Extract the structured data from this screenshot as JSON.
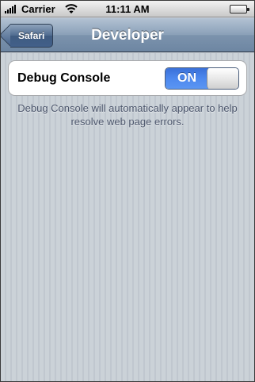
{
  "status_bar": {
    "carrier": "Carrier",
    "time": "11:11 AM",
    "icons": [
      "signal-bars-icon",
      "wifi-icon",
      "battery-icon"
    ]
  },
  "nav_bar": {
    "back_label": "Safari",
    "title": "Developer"
  },
  "settings": {
    "debug_console": {
      "label": "Debug Console",
      "toggle_state": "ON",
      "enabled": true,
      "description": "Debug Console will automatically appear to help resolve web page errors."
    }
  },
  "colors": {
    "nav_bar": "#7c93ad",
    "switch_on": "#4d88ee",
    "background": "#c5ccd4",
    "footer_text": "#4c566c"
  }
}
